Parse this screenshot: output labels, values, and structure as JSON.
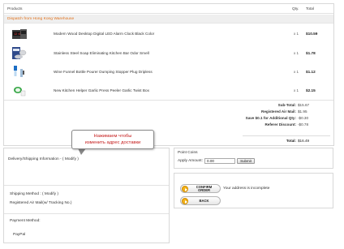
{
  "products": {
    "header": {
      "products": "Products",
      "qty": "Qty.",
      "total": "Total"
    },
    "warehouse": "Dispatch from Hong Kong Warehouse",
    "items": [
      {
        "name": "Modern Wood Desktop Digital LED Alarm Clock Black Color",
        "qty": "x 1",
        "price": "$10.59"
      },
      {
        "name": "Stainless Steel Soap Eliminating Kitchen Bar Odor Smell",
        "qty": "x 1",
        "price": "$1.78"
      },
      {
        "name": "Wine Funnel Bottle Pourer Dumping Stopper Plug Dripless",
        "qty": "x 1",
        "price": "$1.12"
      },
      {
        "name": "New Kitchen Helper Garlic Press Peeler Garlic Twist Box",
        "qty": "x 1",
        "price": "$2.15"
      }
    ]
  },
  "totals": [
    {
      "label": "Sub-Total:",
      "value": "$15.67"
    },
    {
      "label": "Registered Air Mail:",
      "value": "$1.95"
    },
    {
      "label": "Save $0.1 for Additional Qty:",
      "value": "-$0.30"
    },
    {
      "label": "Referer Discount:",
      "value": "-$0.78"
    }
  ],
  "grand_total": {
    "label": "Total:",
    "value": "$16.49"
  },
  "callout": {
    "line1": "Нажимаем чтобы",
    "line2": "изменить адрес доставки"
  },
  "delivery": {
    "info_label": "Delivery/Shipping Information - ( Modify )",
    "shipping_method_label": "Shipping Method : ( Modify )",
    "shipping_method_value": "Registered Air Mail(w/ Tracking No.)",
    "payment_label": "Payment Method:",
    "payment_value": "PayPal"
  },
  "points": {
    "title": "Point Coins",
    "amount_label": "Apply Amount:",
    "amount_value": "0.00",
    "submit_label": "Submit"
  },
  "actions": {
    "confirm_line1": "CONFIRM",
    "confirm_line2": "ORDER",
    "back_label": "BACK",
    "status_text": "Your address is incomplete"
  }
}
